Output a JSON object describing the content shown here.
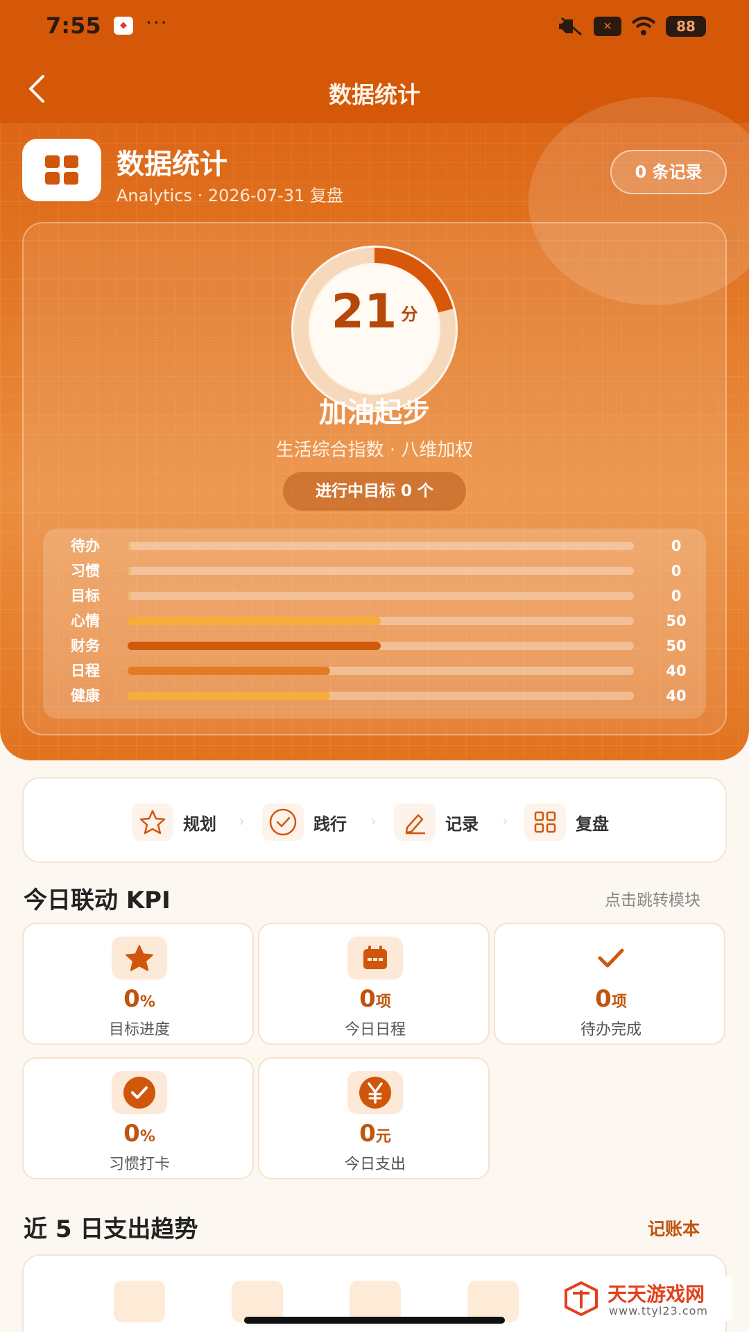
{
  "status_bar": {
    "time": "7:55",
    "battery": "88"
  },
  "nav": {
    "title": "数据统计"
  },
  "module": {
    "title": "数据统计",
    "subtitle": "Analytics · 2026-07-31 复盘",
    "records": "0 条记录"
  },
  "score": {
    "value": "21",
    "unit": "分",
    "progress_fraction": 0.21,
    "level": "加油起步",
    "description": "生活综合指数 · 八维加权",
    "goals_pill": "进行中目标 0 个"
  },
  "dimensions": [
    {
      "label": "待办",
      "value": "0",
      "fraction": 0.0,
      "color": "#f2b36b"
    },
    {
      "label": "习惯",
      "value": "0",
      "fraction": 0.0,
      "color": "#f2b36b"
    },
    {
      "label": "目标",
      "value": "0",
      "fraction": 0.0,
      "color": "#f2b36b"
    },
    {
      "label": "心情",
      "value": "50",
      "fraction": 0.5,
      "color": "#f6ad3b"
    },
    {
      "label": "财务",
      "value": "50",
      "fraction": 0.5,
      "color": "#cf5a0c"
    },
    {
      "label": "日程",
      "value": "40",
      "fraction": 0.4,
      "color": "#e57a22"
    },
    {
      "label": "健康",
      "value": "40",
      "fraction": 0.4,
      "color": "#f6ad3b"
    }
  ],
  "flow": [
    {
      "label": "规划",
      "icon": "star-outline-icon"
    },
    {
      "label": "践行",
      "icon": "check-circle-icon"
    },
    {
      "label": "记录",
      "icon": "pencil-icon"
    },
    {
      "label": "复盘",
      "icon": "grid-icon"
    }
  ],
  "kpi_section": {
    "title": "今日联动 KPI",
    "link": "点击跳转模块"
  },
  "kpis": [
    {
      "value": "0",
      "unit": "%",
      "label": "目标进度",
      "icon": "star-icon"
    },
    {
      "value": "0",
      "unit": "项",
      "label": "今日日程",
      "icon": "calendar-icon"
    },
    {
      "value": "0",
      "unit": "项",
      "label": "待办完成",
      "icon": "check-icon"
    },
    {
      "value": "0",
      "unit": "%",
      "label": "习惯打卡",
      "icon": "check-circle-icon"
    },
    {
      "value": "0",
      "unit": "元",
      "label": "今日支出",
      "icon": "yen-icon"
    }
  ],
  "trend_section": {
    "title": "近 5 日支出趋势",
    "link": "记账本"
  },
  "watermark": {
    "text": "天天游戏网",
    "url": "www.ttyl23.com"
  },
  "colors": {
    "primary": "#d8580a",
    "accent": "#c0540d",
    "background": "#fdf7f1"
  }
}
